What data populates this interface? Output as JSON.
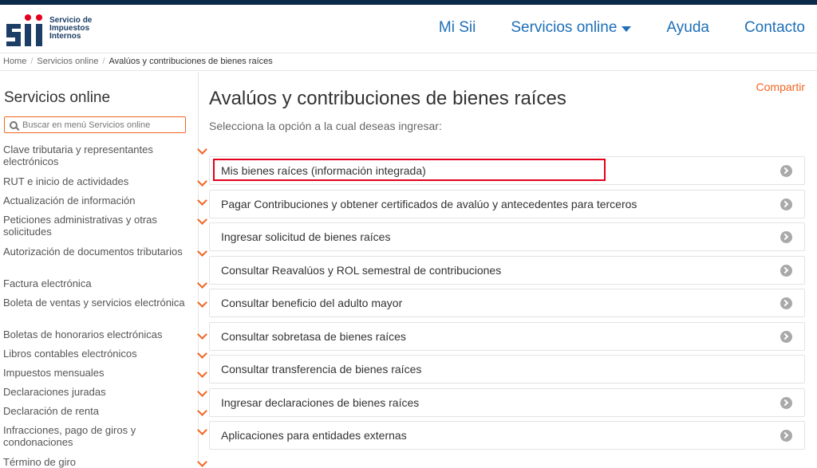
{
  "header": {
    "logo_lines": [
      "Servicio de",
      "Impuestos",
      "Internos"
    ],
    "nav": [
      {
        "label": "Mi Sii"
      },
      {
        "label": "Servicios online",
        "has_dropdown": true
      },
      {
        "label": "Ayuda"
      },
      {
        "label": "Contacto"
      }
    ]
  },
  "breadcrumb": {
    "items": [
      "Home",
      "Servicios online"
    ],
    "current": "Avalúos y contribuciones de bienes raíces"
  },
  "sidebar": {
    "title": "Servicios online",
    "search_placeholder": "Buscar en menú Servicios online",
    "items": [
      "Clave tributaria y representantes electrónicos",
      "RUT e inicio de actividades",
      "Actualización de información",
      "Peticiones administrativas y otras solicitudes",
      "Autorización de documentos tributarios",
      "Factura electrónica",
      "Boleta de ventas y servicios electrónica",
      "Boletas de honorarios electrónicas",
      "Libros contables electrónicos",
      "Impuestos mensuales",
      "Declaraciones juradas",
      "Declaración de renta",
      "Infracciones, pago de giros y condonaciones",
      "Término de giro"
    ]
  },
  "main": {
    "share": "Compartir",
    "title": "Avalúos y contribuciones de bienes raíces",
    "subtitle": "Selecciona la opción a la cual deseas ingresar:",
    "options": [
      {
        "label": "Mis bienes raíces (información integrada)",
        "arrow": true,
        "highlighted": true
      },
      {
        "label": "Pagar Contribuciones y obtener certificados de avalúo y antecedentes para terceros",
        "arrow": true
      },
      {
        "label": "Ingresar solicitud de bienes raíces",
        "arrow": true
      },
      {
        "label": "Consultar Reavalúos y ROL semestral de contribuciones",
        "arrow": true
      },
      {
        "label": "Consultar beneficio del adulto mayor",
        "arrow": true
      },
      {
        "label": "Consultar sobretasa de bienes raíces",
        "arrow": true
      },
      {
        "label": "Consultar transferencia de bienes raíces",
        "arrow": false
      },
      {
        "label": "Ingresar declaraciones de bienes raíces",
        "arrow": true
      },
      {
        "label": "Aplicaciones para entidades externas",
        "arrow": true
      }
    ]
  },
  "colors": {
    "brand_navy": "#0b2a4a",
    "link_blue": "#1d6fb8",
    "accent_orange": "#f26522",
    "highlight_red": "#e3001b"
  }
}
